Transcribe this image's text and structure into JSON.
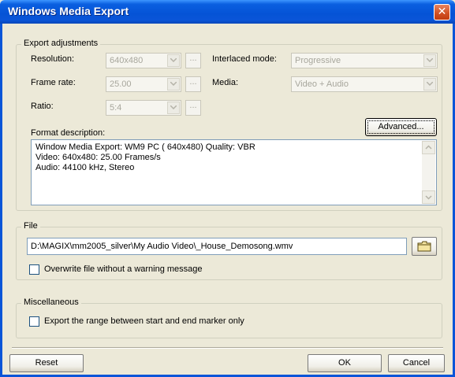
{
  "window": {
    "title": "Windows Media Export"
  },
  "export_adjustments": {
    "legend": "Export adjustments",
    "resolution": {
      "label": "Resolution:",
      "value": "640x480"
    },
    "frame_rate": {
      "label": "Frame rate:",
      "value": "25.00"
    },
    "ratio": {
      "label": "Ratio:",
      "value": "5:4"
    },
    "interlaced": {
      "label": "Interlaced mode:",
      "value": "Progressive"
    },
    "media": {
      "label": "Media:",
      "value": "Video + Audio"
    },
    "dots_label": "...",
    "format_label": "Format description:",
    "advanced_label": "Advanced...",
    "format_lines": [
      "Window Media Export:  WM9 PC ( 640x480) Quality: VBR",
      "Video: 640x480: 25.00 Frames/s",
      "Audio: 44100 kHz, Stereo"
    ]
  },
  "file": {
    "legend": "File",
    "path": "D:\\MAGIX\\mm2005_silver\\My Audio Video\\_House_Demosong.wmv",
    "overwrite_label": "Overwrite file without a warning message"
  },
  "misc": {
    "legend": "Miscellaneous",
    "range_label": "Export the range between start and end marker only"
  },
  "buttons": {
    "reset": "Reset",
    "ok": "OK",
    "cancel": "Cancel"
  }
}
